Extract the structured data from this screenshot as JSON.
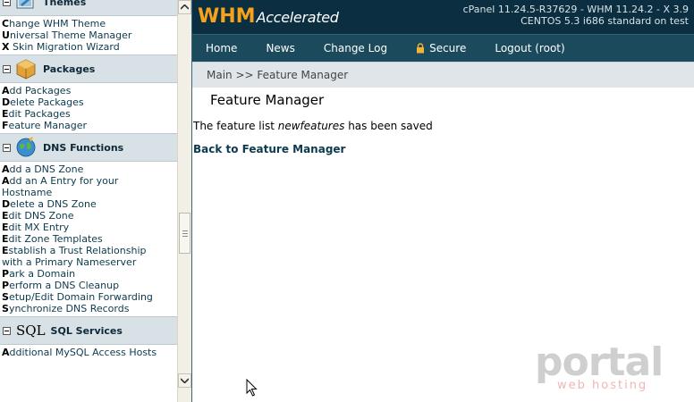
{
  "sidebar": {
    "sections": [
      {
        "title": "Themes",
        "icon": "themes-icon",
        "items": [
          {
            "first": "C",
            "rest": "hange WHM Theme"
          },
          {
            "first": "U",
            "rest": "niversal Theme Manager"
          },
          {
            "first": "X",
            "rest": " Skin Migration Wizard"
          }
        ]
      },
      {
        "title": "Packages",
        "icon": "packages-icon",
        "items": [
          {
            "first": "A",
            "rest": "dd Packages"
          },
          {
            "first": "D",
            "rest": "elete Packages"
          },
          {
            "first": "E",
            "rest": "dit Packages"
          },
          {
            "first": "F",
            "rest": "eature Manager"
          }
        ]
      },
      {
        "title": "DNS Functions",
        "icon": "dns-globe-icon",
        "items": [
          {
            "first": "A",
            "rest": "dd a DNS Zone"
          },
          {
            "first": "A",
            "rest": "dd an A Entry for your"
          },
          {
            "first": "",
            "rest": "Hostname"
          },
          {
            "first": "D",
            "rest": "elete a DNS Zone"
          },
          {
            "first": "E",
            "rest": "dit DNS Zone"
          },
          {
            "first": "E",
            "rest": "dit MX Entry"
          },
          {
            "first": "E",
            "rest": "dit Zone Templates"
          },
          {
            "first": "E",
            "rest": "stablish a Trust Relationship"
          },
          {
            "first": "",
            "rest": "with a Primary Nameserver"
          },
          {
            "first": "P",
            "rest": "ark a Domain"
          },
          {
            "first": "P",
            "rest": "erform a DNS Cleanup"
          },
          {
            "first": "S",
            "rest": "etup/Edit Domain Forwarding"
          },
          {
            "first": "S",
            "rest": "ynchronize DNS Records"
          }
        ]
      },
      {
        "title": "SQL Services",
        "icon": "sql-icon",
        "icon_text": "SQL",
        "items": [
          {
            "first": "A",
            "rest": "dditional MySQL Access Hosts"
          }
        ]
      }
    ]
  },
  "header": {
    "logo_main": "WHM",
    "logo_sub": "Accelerated",
    "version_line1": "cPanel 11.24.5-R37629 - WHM 11.24.2 - X 3.9",
    "version_line2": "CENTOS 5.3 i686 standard on test"
  },
  "nav": {
    "home": "Home",
    "news": "News",
    "changelog": "Change Log",
    "secure": "Secure",
    "logout": "Logout (root)"
  },
  "breadcrumb": "Main >> Feature Manager",
  "content": {
    "title": "Feature Manager",
    "message_prefix": "The feature list ",
    "message_name": "newfeatures",
    "message_suffix": " has been saved",
    "back_link": "Back to Feature Manager"
  },
  "watermark": {
    "brand": "portal",
    "tagline": "web hosting"
  },
  "colors": {
    "accent_orange": "#f6a21a",
    "topbar": "#0b2f40",
    "navbar": "#1a4a5c",
    "link": "#0b3a4f"
  }
}
